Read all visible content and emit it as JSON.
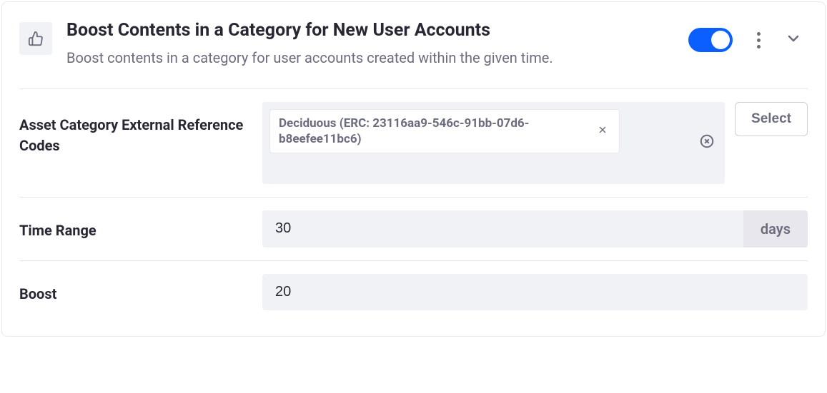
{
  "header": {
    "title": "Boost Contents in a Category for New User Accounts",
    "description": "Boost contents in a category for user accounts created within the given time.",
    "enabled": true
  },
  "fields": {
    "asset_category": {
      "label": "Asset Category External Reference Codes",
      "select_label": "Select",
      "tags": [
        "Deciduous (ERC: 23116aa9-546c-91bb-07d6-b8eefee11bc6)"
      ]
    },
    "time_range": {
      "label": "Time Range",
      "value": "30",
      "unit": "days"
    },
    "boost": {
      "label": "Boost",
      "value": "20"
    }
  }
}
